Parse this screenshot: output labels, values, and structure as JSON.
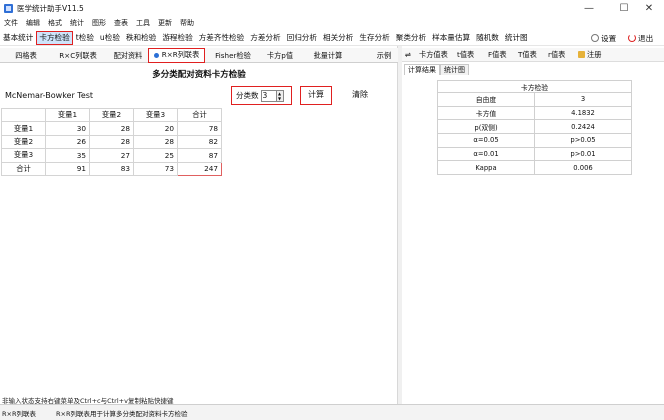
{
  "window": {
    "title": "医学统计助手V11.5",
    "minimize": "—",
    "maximize": "☐",
    "close": "✕"
  },
  "menubar": [
    "文件",
    "编辑",
    "格式",
    "统计",
    "图形",
    "查表",
    "工具",
    "更新",
    "帮助"
  ],
  "mainmenu": {
    "items": [
      "基本统计",
      "卡方检验",
      "t检验",
      "u检验",
      "秩和检验",
      "游程检验",
      "方差齐性检验",
      "方差分析",
      "回归分析",
      "相关分析",
      "生存分析",
      "聚类分析",
      "样本量估算",
      "随机数",
      "统计图"
    ],
    "active_index": 1,
    "settings_label": "设置",
    "exit_label": "退出"
  },
  "subtabs": {
    "items": [
      "四格表",
      "R×C列联表",
      "配对资料",
      "R×R列联表",
      "Fisher检验",
      "卡方p值",
      "批量计算",
      "示例"
    ],
    "active_index": 3
  },
  "panel": {
    "heading": "多分类配对资料卡方检验",
    "test_name": "McNemar-Bowker Test",
    "category_label": "分类数",
    "category_value": "3",
    "calc_label": "计算",
    "clear_label": "清除"
  },
  "grid": {
    "headers": [
      "变量1",
      "变量2",
      "变量3",
      "合计"
    ],
    "rows": [
      {
        "label": "变量1",
        "cells": [
          "30",
          "28",
          "20",
          "78"
        ]
      },
      {
        "label": "变量2",
        "cells": [
          "26",
          "28",
          "28",
          "82"
        ]
      },
      {
        "label": "变量3",
        "cells": [
          "35",
          "27",
          "25",
          "87"
        ]
      },
      {
        "label": "合计",
        "cells": [
          "91",
          "83",
          "73",
          "247"
        ]
      }
    ]
  },
  "left_status": "非输入状态支持右键菜单及Ctrl+c与Ctrl+v复制粘贴快捷键",
  "right_toolbar": {
    "swap_icon": "⇌",
    "items": [
      "卡方值表",
      "t值表",
      "F值表",
      "T值表",
      "r值表",
      "注册"
    ]
  },
  "right_tabs": [
    "计算结果",
    "统计图"
  ],
  "result": {
    "caption": "卡方检验",
    "rows": [
      {
        "key": "自由度",
        "value": "3"
      },
      {
        "key": "卡方值",
        "value": "4.1832"
      },
      {
        "key": "p(双侧)",
        "value": "0.2424"
      },
      {
        "key": "α=0.05",
        "value": "p>0.05"
      },
      {
        "key": "α=0.01",
        "value": "p>0.01"
      },
      {
        "key": "Kappa",
        "value": "0.006"
      }
    ]
  },
  "statusbar": {
    "left": "R×R列联表",
    "right": "R×R列联表用于计算多分类配对资料卡方检验"
  }
}
